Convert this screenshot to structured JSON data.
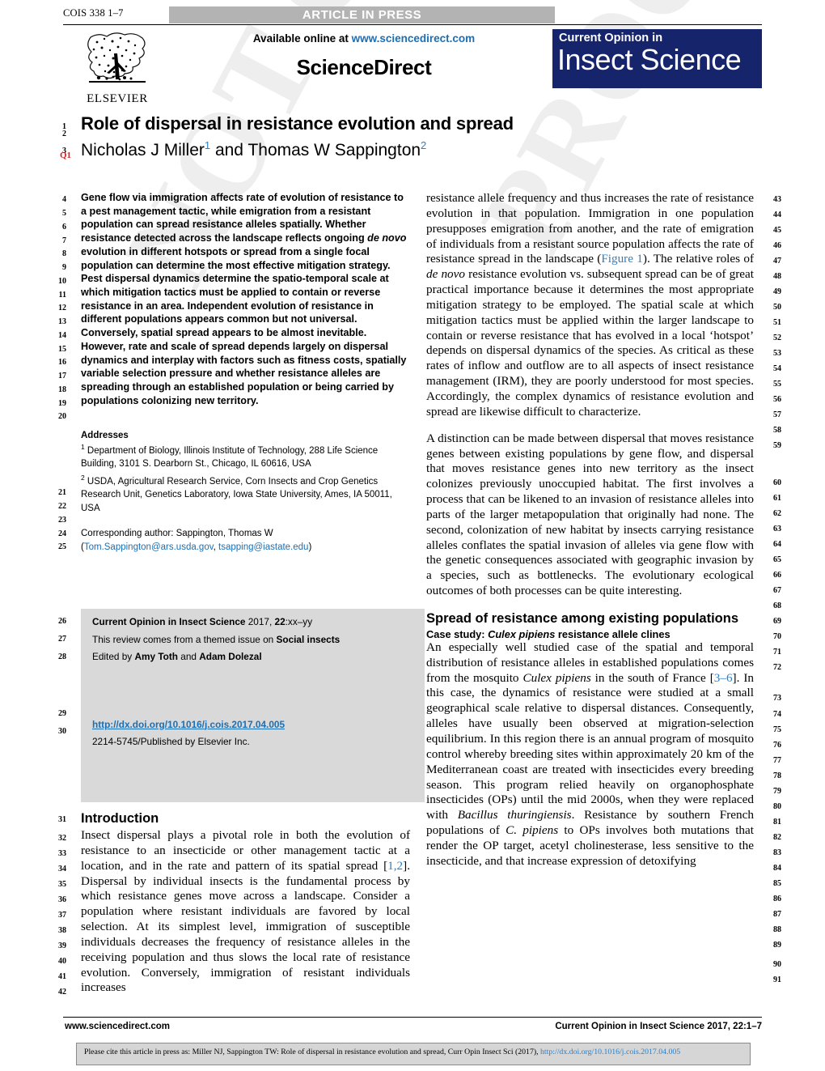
{
  "header": {
    "article_id": "COIS 338 1–7",
    "status_banner": "ARTICLE IN PRESS",
    "available_online": "Available online at",
    "sciencedirect_url": "www.sciencedirect.com",
    "sciencedirect_logo": "ScienceDirect",
    "publisher_logo_text": "ELSEVIER",
    "journal_mast_small": "Current Opinion in",
    "journal_mast_big": "Insect Science",
    "mast_color": "#15246b",
    "link_color": "#1a6fb5"
  },
  "article": {
    "title": "Role of dispersal in resistance evolution and spread",
    "authors_part1": "Nicholas J Miller",
    "authors_sup1": "1",
    "authors_join": " and ",
    "authors_part2": "Thomas W Sappington",
    "authors_sup2": "2",
    "query_flag": "Q1"
  },
  "abstract": {
    "text": "Gene flow via immigration affects rate of evolution of resistance to a pest management tactic, while emigration from a resistant population can spread resistance alleles spatially. Whether resistance detected across the landscape reflects ongoing ",
    "italic1": "de novo",
    "text2": " evolution in different hotspots or spread from a single focal population can determine the most effective mitigation strategy. Pest dispersal dynamics determine the spatio-temporal scale at which mitigation tactics must be applied to contain or reverse resistance in an area. Independent evolution of resistance in different populations appears common but not universal. Conversely, spatial spread appears to be almost inevitable. However, rate and scale of spread depends largely on dispersal dynamics and interplay with factors such as fitness costs, spatially variable selection pressure and whether resistance alleles are spreading through an established population or being carried by populations colonizing new territory."
  },
  "addresses": {
    "heading": "Addresses",
    "aff1_sup": "1",
    "aff1": " Department of Biology, Illinois Institute of Technology, 288 Life Science Building, 3101 S. Dearborn St., Chicago, IL 60616, USA",
    "aff2_sup": "2",
    "aff2": " USDA, Agricultural Research Service, Corn Insects and Crop Genetics Research Unit, Genetics Laboratory, Iowa State University, Ames, IA 50011, USA",
    "corresponding_label": "Corresponding author: Sappington, Thomas W",
    "email1": "Tom.Sappington@ars.usda.gov",
    "email_sep": ", ",
    "email2": "tsapping@iastate.edu"
  },
  "journal_box": {
    "citation_bold": "Current Opinion in Insect Science",
    "citation_rest": " 2017, ",
    "citation_volume": "22",
    "citation_pages": ":xx–yy",
    "themed_prefix": "This review comes from a themed issue on ",
    "themed_topic": "Social insects",
    "edited_prefix": "Edited by ",
    "editor1": "Amy Toth",
    "edited_join": " and ",
    "editor2": "Adam Dolezal",
    "doi": "http://dx.doi.org/10.1016/j.cois.2017.04.005",
    "issn_line": "2214-5745/Published by Elsevier Inc."
  },
  "introduction": {
    "heading": "Introduction",
    "p1_a": "Insect dispersal plays a pivotal role in both the evolution of resistance to an insecticide or other management tactic at a location, and in the rate and pattern of its spatial spread [",
    "p1_ref": "1,2",
    "p1_b": "]. Dispersal by individual insects is the fundamental process by which resistance genes move across a landscape. Consider a population where resistant individuals are favored by local selection. At its simplest level, immigration of susceptible individuals decreases the frequency of resistance alleles in the receiving population and thus slows the local rate of resistance evolution. Conversely, immigration of resistant individuals increases"
  },
  "right_column": {
    "p1_a": "resistance allele frequency and thus increases the rate of resistance evolution in that population. Immigration in one population presupposes emigration from another, and the rate of emigration of individuals from a resistant source population affects the rate of resistance spread in the landscape (",
    "p1_figref": "Figure 1",
    "p1_b": "). The relative roles of ",
    "p1_italic": "de novo",
    "p1_c": " resistance evolution vs. subsequent spread can be of great practical importance because it determines the most appropriate mitigation strategy to be employed. The spatial scale at which mitigation tactics must be applied within the larger landscape to contain or reverse resistance that has evolved in a local ‘hotspot’ depends on dispersal dynamics of the species. As critical as these rates of inflow and outflow are to all aspects of insect resistance management (IRM), they are poorly understood for most species. Accordingly, the complex dynamics of resistance evolution and spread are likewise difficult to characterize.",
    "p2": "A distinction can be made between dispersal that moves resistance genes between existing populations by gene flow, and dispersal that moves resistance genes into new territory as the insect colonizes previously unoccupied habitat. The first involves a process that can be likened to an invasion of resistance alleles into parts of the larger metapopulation that originally had none. The second, colonization of new habitat by insects carrying resistance alleles conflates the spatial invasion of alleles via gene flow with the genetic consequences associated with geographic invasion by a species, such as bottlenecks. The evolutionary ecological outcomes of both processes can be quite interesting.",
    "section_heading": "Spread of resistance among existing populations",
    "case_study_prefix": "Case study: ",
    "case_study_italic": "Culex pipiens",
    "case_study_rest": " resistance allele clines",
    "p3_a": "An especially well studied case of the spatial and temporal distribution of resistance alleles in established populations comes from the mosquito ",
    "p3_italic1": "Culex pipiens",
    "p3_b": " in the south of France [",
    "p3_ref": "3–6",
    "p3_c": "]. In this case, the dynamics of resistance were studied at a small geographical scale relative to dispersal distances. Consequently, alleles have usually been observed at migration-selection equilibrium. In this region there is an annual program of mosquito control whereby breeding sites within approximately 20 km of the Mediterranean coast are treated with insecticides every breeding season. This program relied heavily on organophosphate insecticides (OPs) until the mid 2000s, when they were replaced with ",
    "p3_italic2": "Bacillus thuringiensis",
    "p3_d": ". Resistance by southern French populations of ",
    "p3_italic3": "C. pipiens",
    "p3_e": " to OPs involves both mutations that render the OP target, acetyl cholinesterase, less sensitive to the insecticide, and that increase expression of detoxifying"
  },
  "footer": {
    "left": "www.sciencedirect.com",
    "right_bold": "Current Opinion in Insect Science",
    "right_rest": " 2017, ",
    "right_volume": "22",
    "right_pages": ":1–7",
    "cite_text": "Please cite this article in press as: Miller  NJ, Sappington  TW: Role of dispersal in resistance evolution and spread, Curr Opin Insect Sci (2017), ",
    "cite_link": "http://dx.doi.org/10.1016/j.cois.2017.04.005"
  },
  "line_numbers": {
    "title_block": [
      "1",
      "2",
      "3"
    ],
    "left_abstract": [
      "4",
      "5",
      "6",
      "7",
      "8",
      "9",
      "10",
      "11",
      "12",
      "13",
      "14",
      "15",
      "16",
      "17",
      "18",
      "19",
      "20"
    ],
    "left_addresses": [
      "21",
      "22",
      "23",
      "24",
      "25"
    ],
    "left_greybox": [
      "26",
      "27",
      "28",
      "29",
      "30"
    ],
    "left_intro": [
      "31",
      "32",
      "33",
      "34",
      "35",
      "36",
      "37",
      "38",
      "39",
      "40",
      "41",
      "42"
    ],
    "right_p1": [
      "43",
      "44",
      "45",
      "46",
      "47",
      "48",
      "49",
      "50",
      "51",
      "52",
      "53",
      "54",
      "55",
      "56",
      "57",
      "58",
      "59"
    ],
    "right_p2": [
      "60",
      "61",
      "62",
      "63",
      "64",
      "65",
      "66",
      "67",
      "68",
      "69",
      "70",
      "71",
      "72"
    ],
    "right_p3": [
      "73",
      "74",
      "75",
      "76",
      "77",
      "78",
      "79",
      "80",
      "81",
      "82",
      "83",
      "84",
      "85",
      "86",
      "87",
      "88",
      "89",
      "90",
      "91"
    ]
  },
  "watermark": {
    "line1": "NOT CORRECTED",
    "line2": "PROOF"
  }
}
